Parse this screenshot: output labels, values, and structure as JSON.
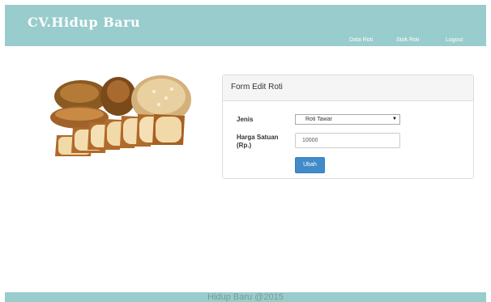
{
  "navbar": {
    "brand": "CV.Hidup Baru",
    "links": [
      {
        "label": "Data Roti"
      },
      {
        "label": "Stok Roti"
      },
      {
        "label": "Logout"
      }
    ]
  },
  "hero_image": {
    "icon": "bread-image"
  },
  "form": {
    "title": "Form Edit Roti",
    "jenis_label": "Jenis",
    "jenis_value": "Roti Tawar",
    "harga_label_line1": "Harga Satuan",
    "harga_label_line2": "(Rp.)",
    "harga_value": "10000",
    "submit_label": "Ubah"
  },
  "footer": {
    "text": "Hidup Baru @2015"
  },
  "colors": {
    "accent": "#99cccc",
    "button": "#428bca"
  }
}
